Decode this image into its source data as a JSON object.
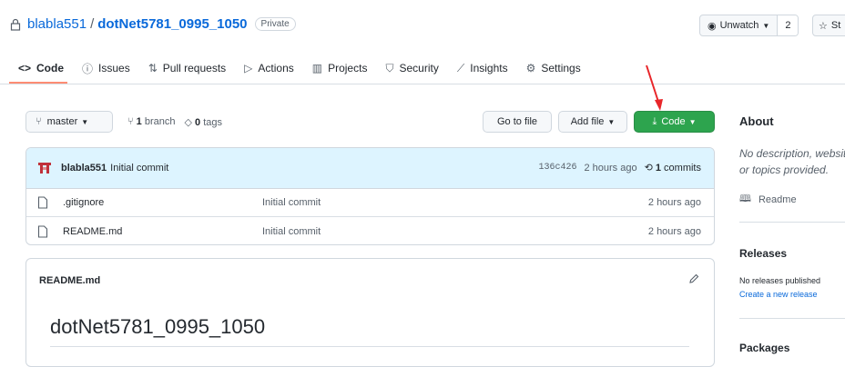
{
  "repo": {
    "owner": "blabla551",
    "separator": "/",
    "name": "dotNet5781_0995_1050",
    "visibility": "Private"
  },
  "header_actions": {
    "watch_label": "Unwatch",
    "watch_count": "2",
    "star_label": "St"
  },
  "tabs": [
    {
      "label": "Code",
      "icon": "code-icon",
      "active": true
    },
    {
      "label": "Issues",
      "icon": "issue-icon"
    },
    {
      "label": "Pull requests",
      "icon": "pull-request-icon"
    },
    {
      "label": "Actions",
      "icon": "play-icon"
    },
    {
      "label": "Projects",
      "icon": "project-icon"
    },
    {
      "label": "Security",
      "icon": "shield-icon"
    },
    {
      "label": "Insights",
      "icon": "graph-icon"
    },
    {
      "label": "Settings",
      "icon": "gear-icon"
    }
  ],
  "toolbar": {
    "branch": "master",
    "branch_count": "1",
    "branch_word": "branch",
    "tag_count": "0",
    "tag_word": "tags",
    "go_to_file": "Go to file",
    "add_file": "Add file",
    "code": "Code"
  },
  "latest_commit": {
    "author": "blabla551",
    "message": "Initial commit",
    "sha": "136c426",
    "time": "2 hours ago",
    "commit_count": "1",
    "commit_word": "commits"
  },
  "files": [
    {
      "name": ".gitignore",
      "message": "Initial commit",
      "time": "2 hours ago"
    },
    {
      "name": "README.md",
      "message": "Initial commit",
      "time": "2 hours ago"
    }
  ],
  "readme": {
    "filename": "README.md",
    "title": "dotNet5781_0995_1050"
  },
  "sidebar": {
    "about_title": "About",
    "about_desc": "No description, website, or topics provided.",
    "readme_label": "Readme",
    "releases_title": "Releases",
    "no_releases": "No releases published",
    "create_release": "Create a new release",
    "packages_title": "Packages"
  },
  "colors": {
    "accent_link": "#0969da",
    "code_button": "#2da44e",
    "tab_underline": "#fd8c73",
    "commit_bar": "#ddf4ff",
    "annotation_arrow": "#e8262a"
  }
}
